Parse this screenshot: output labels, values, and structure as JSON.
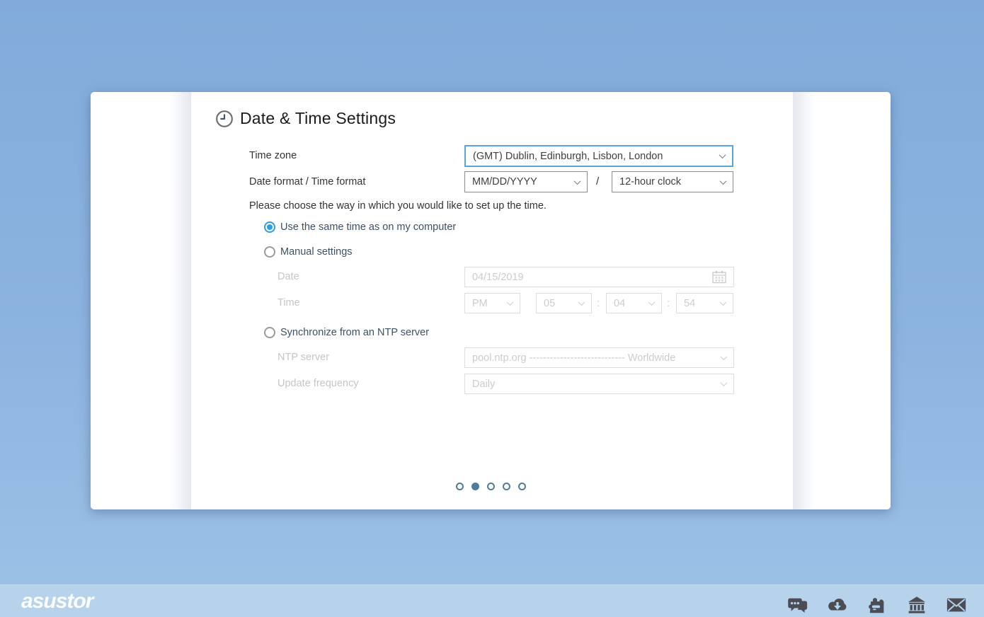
{
  "page": {
    "title": "Date & Time Settings"
  },
  "form": {
    "timezone": {
      "label": "Time zone",
      "value": "(GMT) Dublin, Edinburgh, Lisbon, London"
    },
    "format": {
      "label": "Date format / Time format",
      "date_value": "MM/DD/YYYY",
      "separator": "/",
      "time_value": "12-hour clock"
    },
    "prompt": "Please choose the way in which you would like to set up the time.",
    "options": {
      "computer": "Use the same time as on my computer",
      "manual": "Manual settings",
      "ntp": "Synchronize from an NTP server",
      "selected": "computer"
    },
    "manual": {
      "date_label": "Date",
      "date_value": "04/15/2019",
      "time_label": "Time",
      "meridiem": "PM",
      "hour": "05",
      "minute": "04",
      "second": "54",
      "colon": ":"
    },
    "ntp": {
      "server_label": "NTP server",
      "server_value": "pool.ntp.org ---------------------------- Worldwide",
      "frequency_label": "Update frequency",
      "frequency_value": "Daily"
    }
  },
  "pagination": {
    "total": 5,
    "active": 2
  },
  "footer": {
    "logo_text": "asustor",
    "icons": [
      "chat-icon",
      "cloud-download-icon",
      "app-central-icon",
      "college-icon",
      "mail-icon"
    ]
  },
  "colors": {
    "background_top": "#82abdb",
    "background_bottom": "#9dc2e7",
    "footer_bar": "#b7d3ec",
    "focus_border": "#57a7d9",
    "radio_selected": "#2d9fe0",
    "pagination_dot": "#4e7c9c",
    "nav_chevron": "#8493bc",
    "footer_icon": "#4c4c54"
  }
}
